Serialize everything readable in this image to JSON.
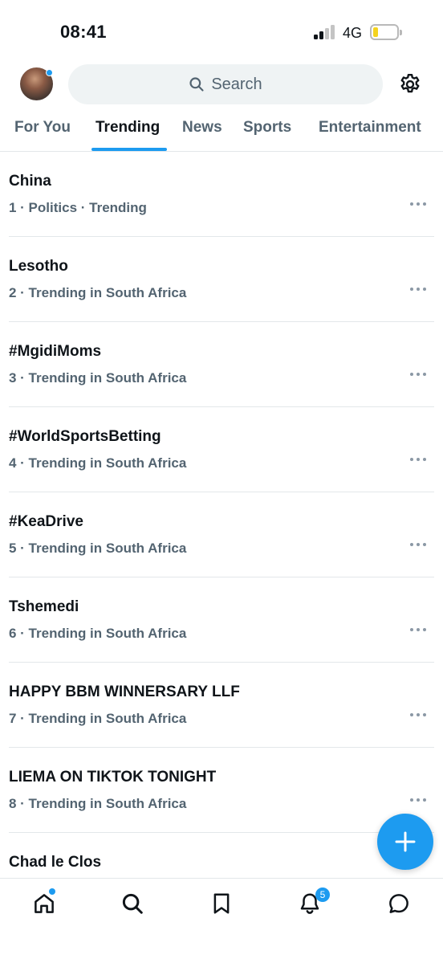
{
  "status_bar": {
    "time": "08:41",
    "network": "4G",
    "battery_level": 0.2,
    "battery_color": "#f4d31f"
  },
  "header": {
    "search_placeholder": "Search",
    "icons": [
      "avatar",
      "search-icon",
      "gear-icon"
    ]
  },
  "tabs": [
    {
      "label": "For You",
      "active": false
    },
    {
      "label": "Trending",
      "active": true
    },
    {
      "label": "News",
      "active": false
    },
    {
      "label": "Sports",
      "active": false
    },
    {
      "label": "Entertainment",
      "active": false
    }
  ],
  "trends": [
    {
      "name": "China",
      "meta": "1 · Politics · Trending"
    },
    {
      "name": "Lesotho",
      "meta": "2 · Trending in South Africa"
    },
    {
      "name": "#MgidiMoms",
      "meta": "3 · Trending in South Africa"
    },
    {
      "name": "#WorldSportsBetting",
      "meta": "4 · Trending in South Africa"
    },
    {
      "name": "#KeaDrive",
      "meta": "5 · Trending in South Africa"
    },
    {
      "name": "Tshemedi",
      "meta": "6 · Trending in South Africa"
    },
    {
      "name": "HAPPY BBM WINNERSARY LLF",
      "meta": "7 · Trending in South Africa"
    },
    {
      "name": "LIEMA ON TIKTOK TONIGHT",
      "meta": "8 · Trending in South Africa"
    },
    {
      "name": "Chad le Clos",
      "meta": ""
    }
  ],
  "bottom_nav": {
    "items": [
      "home-icon",
      "search-icon",
      "bookmark-icon",
      "bell-icon",
      "message-icon"
    ],
    "notifications_badge": "5"
  },
  "colors": {
    "accent": "#1d9bf0",
    "text_primary": "#0f1419",
    "text_secondary": "#536471",
    "divider": "#e3e7ea"
  }
}
